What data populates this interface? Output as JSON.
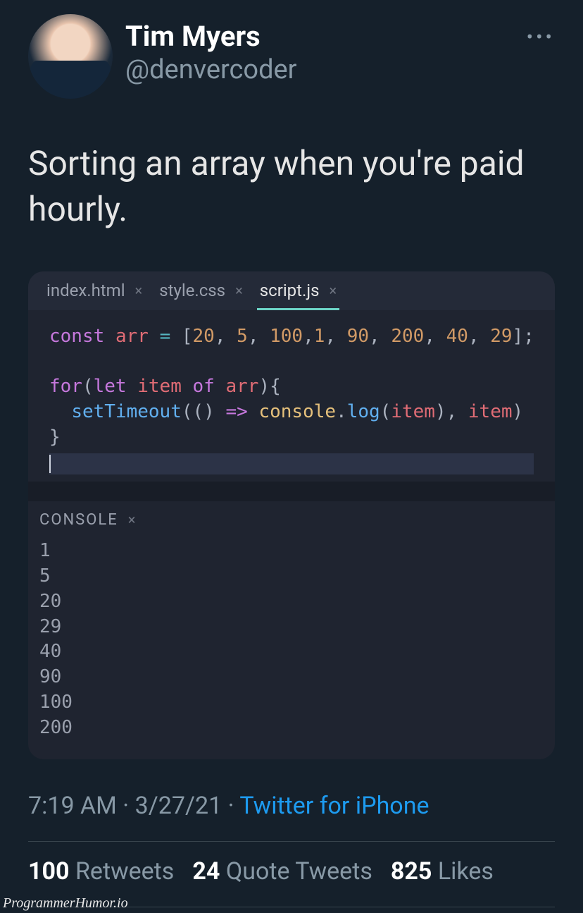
{
  "author": {
    "display_name": "Tim Myers",
    "handle": "@denvercoder"
  },
  "more_glyph": "•••",
  "body": "Sorting an array when you're paid hourly.",
  "editor": {
    "tabs": [
      {
        "label": "index.html",
        "active": false
      },
      {
        "label": "style.css",
        "active": false
      },
      {
        "label": "script.js",
        "active": true
      }
    ],
    "close_glyph": "×",
    "code_tokens": {
      "l1_const": "const",
      "l1_arr": "arr",
      "l1_eq": "=",
      "l1_open": "[",
      "n20": "20",
      "n5": "5",
      "n100": "100",
      "n1": "1",
      "n90": "90",
      "n200": "200",
      "n40": "40",
      "n29": "29",
      "comma": ", ",
      "commaTight": ",",
      "l1_close": "];",
      "l3_for": "for",
      "l3_paren_o": "(",
      "l3_let": "let",
      "l3_item": "item",
      "l3_of": "of",
      "l3_arr": "arr",
      "l3_paren_c": ")",
      "l3_brace_o": "{",
      "l4_setTimeout": "setTimeout",
      "l4_po": "(",
      "l4_unit": "()",
      "l4_arrow": "=>",
      "l4_console": "console",
      "l4_dot": ".",
      "l4_log": "log",
      "l4_po2": "(",
      "l4_item1": "item",
      "l4_pc": ")",
      "l4_comma": ", ",
      "l4_item2": "item",
      "l4_pc2": ")",
      "l5_brace_c": "}"
    },
    "console": {
      "label": "CONSOLE",
      "lines": [
        "1",
        "5",
        "20",
        "29",
        "40",
        "90",
        "100",
        "200"
      ]
    }
  },
  "meta": {
    "time": "7:19 AM",
    "date": "3/27/21",
    "source": "Twitter for iPhone",
    "dot": " · "
  },
  "stats": {
    "retweets_count": "100",
    "retweets_label": "Retweets",
    "quotes_count": "24",
    "quotes_label": "Quote Tweets",
    "likes_count": "825",
    "likes_label": "Likes"
  },
  "watermark": "ProgrammerHumor.io"
}
